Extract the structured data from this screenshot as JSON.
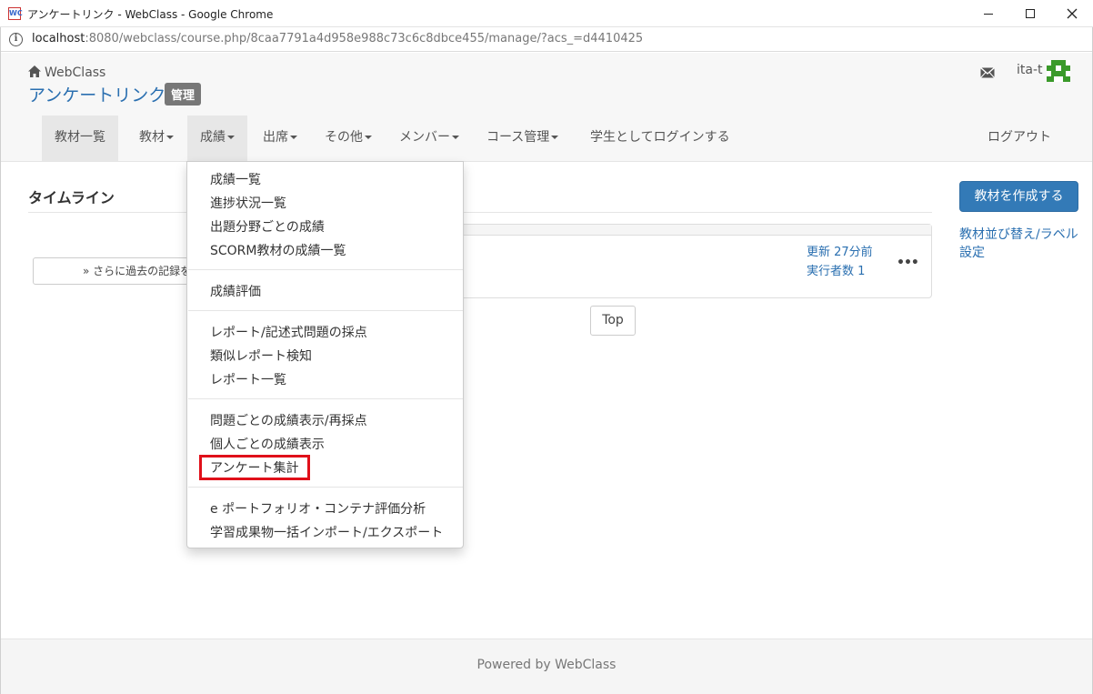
{
  "window": {
    "title": "アンケートリンク - WebClass - Google Chrome",
    "favicon_text": "WC"
  },
  "address_bar": {
    "host": "localhost",
    "rest": ":8080/webclass/course.php/8caa7791a4d958e988c73c6c8dbce455/manage/?acs_=d4410425"
  },
  "header": {
    "home_label": "WebClass",
    "course_title": "アンケートリンク",
    "admin_badge": "管理",
    "user_name": "ita-t"
  },
  "nav": {
    "items": [
      {
        "label": "教材一覧",
        "has_caret": false
      },
      {
        "label": "教材",
        "has_caret": true
      },
      {
        "label": "成績",
        "has_caret": true
      },
      {
        "label": "出席",
        "has_caret": true
      },
      {
        "label": "その他",
        "has_caret": true
      },
      {
        "label": "メンバー",
        "has_caret": true
      },
      {
        "label": "コース管理",
        "has_caret": true
      },
      {
        "label": "学生としてログインする",
        "has_caret": false
      }
    ],
    "logout": "ログアウト"
  },
  "main": {
    "timeline_heading": "タイムライン",
    "more_button": "» さらに過去の記録を",
    "card": {
      "updated": "更新 27分前",
      "exec_count": "実行者数 1",
      "menu_dots": "•••"
    },
    "top_button": "Top"
  },
  "sidebar": {
    "create_button": "教材を作成する",
    "sort_link": "教材並び替え/ラベル設定"
  },
  "dropdown": {
    "items": [
      "成績一覧",
      "進捗状況一覧",
      "出題分野ごとの成績",
      "SCORM教材の成績一覧",
      "成績評価",
      "レポート/記述式問題の採点",
      "類似レポート検知",
      "レポート一覧",
      "問題ごとの成績表示/再採点",
      "個人ごとの成績表示",
      "アンケート集計",
      "e ポートフォリオ・コンテナ評価分析",
      "学習成果物一括インポート/エクスポート"
    ],
    "highlighted": "アンケート集計"
  },
  "footer": {
    "text": "Powered by WebClass"
  },
  "colors": {
    "link": "#2a6fb0",
    "primary_button": "#337ab7",
    "highlight_box": "#e0101a",
    "badge": "#777777"
  }
}
